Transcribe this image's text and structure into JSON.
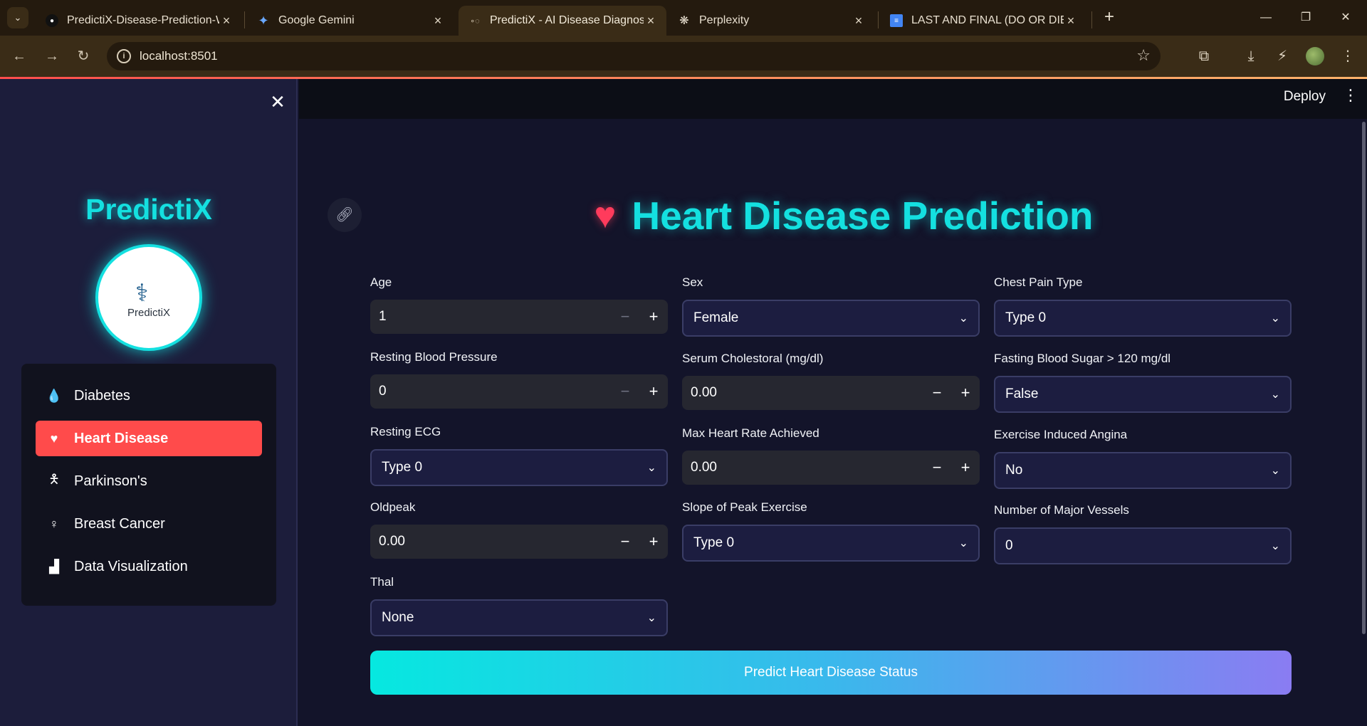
{
  "browser": {
    "tabs": [
      {
        "label": "PredictiX-Disease-Prediction-W",
        "icon": "github-icon"
      },
      {
        "label": "Google Gemini",
        "icon": "gemini-icon"
      },
      {
        "label": "PredictiX - AI Disease Diagnosis",
        "icon": "loading-icon"
      },
      {
        "label": "Perplexity",
        "icon": "perplexity-icon"
      },
      {
        "label": "LAST AND FINAL (DO OR DIE) -",
        "icon": "docs-icon"
      }
    ],
    "url": "localhost:8501"
  },
  "sidebar": {
    "brand": "PredictiX",
    "logo_text": "PredictiX",
    "menu": [
      {
        "label": "Diabetes",
        "icon": "drop-icon"
      },
      {
        "label": "Heart Disease",
        "icon": "heart-pulse-icon"
      },
      {
        "label": "Parkinson's",
        "icon": "person-icon"
      },
      {
        "label": "Breast Cancer",
        "icon": "female-icon"
      },
      {
        "label": "Data Visualization",
        "icon": "bar-chart-icon"
      }
    ],
    "active_index": 1
  },
  "header": {
    "deploy_label": "Deploy"
  },
  "page": {
    "title": "Heart Disease Prediction"
  },
  "form": {
    "age": {
      "label": "Age",
      "value": "1"
    },
    "sex": {
      "label": "Sex",
      "value": "Female"
    },
    "chest_pain": {
      "label": "Chest Pain Type",
      "value": "Type 0"
    },
    "resting_bp": {
      "label": "Resting Blood Pressure",
      "value": "0"
    },
    "cholesterol": {
      "label": "Serum Cholestoral (mg/dl)",
      "value": "0.00"
    },
    "fasting_sugar": {
      "label": "Fasting Blood Sugar > 120 mg/dl",
      "value": "False"
    },
    "resting_ecg": {
      "label": "Resting ECG",
      "value": "Type 0"
    },
    "max_hr": {
      "label": "Max Heart Rate Achieved",
      "value": "0.00"
    },
    "angina": {
      "label": "Exercise Induced Angina",
      "value": "No"
    },
    "oldpeak": {
      "label": "Oldpeak",
      "value": "0.00"
    },
    "slope": {
      "label": "Slope of Peak Exercise",
      "value": "Type 0"
    },
    "vessels": {
      "label": "Number of Major Vessels",
      "value": "0"
    },
    "thal": {
      "label": "Thal",
      "value": "None"
    }
  },
  "predict_button": "Predict Heart Disease Status",
  "colors": {
    "accent": "#14e0e0",
    "active_nav": "#ff4b4b",
    "background": "#13142a"
  }
}
